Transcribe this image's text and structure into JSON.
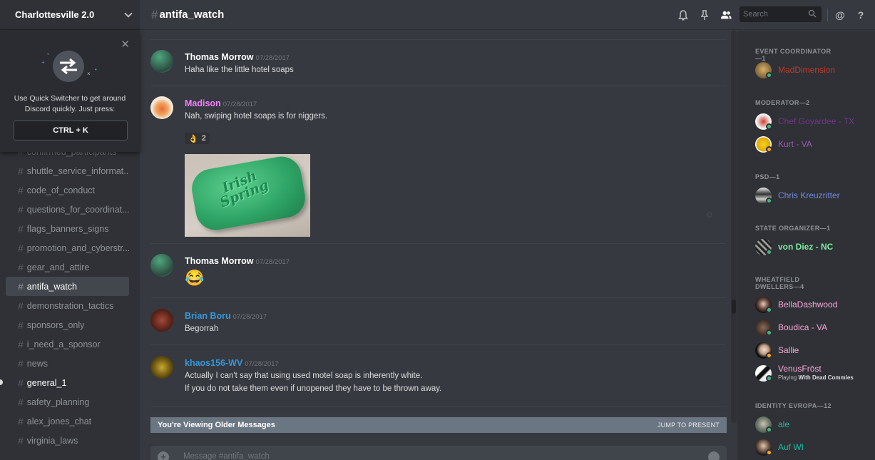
{
  "server": {
    "name": "Charlottesville 2.0"
  },
  "switcher": {
    "line1": "Use Quick Switcher to get around",
    "line2": "Discord quickly. Just press:",
    "key": "CTRL + K"
  },
  "channels": [
    {
      "name": "confirmed_participants",
      "state": "partial"
    },
    {
      "name": "shuttle_service_informat...",
      "state": "normal"
    },
    {
      "name": "code_of_conduct",
      "state": "normal"
    },
    {
      "name": "questions_for_coordinat...",
      "state": "normal"
    },
    {
      "name": "flags_banners_signs",
      "state": "normal"
    },
    {
      "name": "promotion_and_cyberstr...",
      "state": "normal"
    },
    {
      "name": "gear_and_attire",
      "state": "normal"
    },
    {
      "name": "antifa_watch",
      "state": "active"
    },
    {
      "name": "demonstration_tactics",
      "state": "normal"
    },
    {
      "name": "sponsors_only",
      "state": "normal"
    },
    {
      "name": "i_need_a_sponsor",
      "state": "normal"
    },
    {
      "name": "news",
      "state": "normal"
    },
    {
      "name": "general_1",
      "state": "unread"
    },
    {
      "name": "safety_planning",
      "state": "normal"
    },
    {
      "name": "alex_jones_chat",
      "state": "normal"
    },
    {
      "name": "virginia_laws",
      "state": "normal"
    }
  ],
  "header": {
    "channel": "antifa_watch",
    "search_placeholder": "Search"
  },
  "messages": [
    {
      "author": "Thomas Morrow",
      "color": "#ffffff",
      "timestamp": "07/28/2017",
      "lines": [
        "Haha like the little hotel soaps"
      ]
    },
    {
      "author": "Madison",
      "color": "#f47fff",
      "timestamp": "07/28/2017",
      "lines": [
        "Nah, swiping hotel soaps is for niggers."
      ],
      "reaction": {
        "emoji": "👌",
        "count": "2"
      },
      "image": {
        "brand_line1": "Irish",
        "brand_line2": "Spring"
      }
    },
    {
      "author": "Thomas Morrow",
      "color": "#ffffff",
      "timestamp": "07/28/2017",
      "lines": [
        "😂"
      ]
    },
    {
      "author": "Brian Boru",
      "color": "#3498db",
      "timestamp": "07/28/2017",
      "lines": [
        "Begorrah"
      ]
    },
    {
      "author": "khaos156-WV",
      "color": "#3498db",
      "timestamp": "07/28/2017",
      "lines": [
        "Actually I can't say that using used motel soap is inherently white.",
        "If you do not take them even if unopened they have to be thrown away."
      ]
    }
  ],
  "older_bar": {
    "label": "You're Viewing Older Messages",
    "jump": "JUMP TO PRESENT"
  },
  "composer": {
    "placeholder": "Message #antifa_watch"
  },
  "roles": [
    {
      "title": "EVENT COORDINATOR—1",
      "members": [
        {
          "name": "MadDimension",
          "color": "#c0392b",
          "status": "online"
        }
      ]
    },
    {
      "title": "MODERATOR—2",
      "members": [
        {
          "name": "Chef Goyardee - TX",
          "color": "#71368a",
          "status": "online"
        },
        {
          "name": "Kurt - VA",
          "color": "#9b59b6",
          "status": "idle"
        }
      ]
    },
    {
      "title": "PSD—1",
      "members": [
        {
          "name": "Chris Kreuzritter",
          "color": "#7289da",
          "status": "online"
        }
      ]
    },
    {
      "title": "STATE ORGANIZER—1",
      "members": [
        {
          "name": "von Diez - NC",
          "color": "#7bed9f",
          "status": "online"
        }
      ]
    },
    {
      "title": "WHEATFIELD DWELLERS—4",
      "members": [
        {
          "name": "BellaDashwood",
          "color": "#f7a8d8",
          "status": "online"
        },
        {
          "name": "Boudica - VA",
          "color": "#f7a8d8",
          "status": "online"
        },
        {
          "name": "Sallie",
          "color": "#f7a8d8",
          "status": "idle"
        },
        {
          "name": "VenusFrōst",
          "color": "#f7a8d8",
          "status": "online",
          "activity_prefix": "Playing ",
          "activity": "With Dead Commies"
        }
      ]
    },
    {
      "title": "IDENTITY EVROPA—12",
      "members": [
        {
          "name": "ale",
          "color": "#1abc9c",
          "status": "online"
        },
        {
          "name": "Auf WI",
          "color": "#1abc9c",
          "status": "idle"
        }
      ]
    }
  ]
}
